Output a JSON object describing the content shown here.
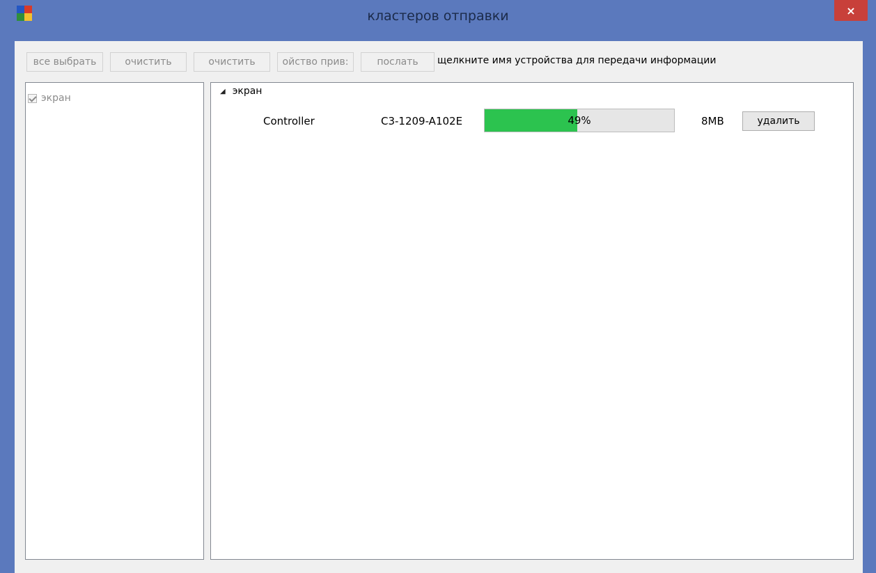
{
  "window": {
    "title": "кластеров отправки",
    "close_label": "×"
  },
  "toolbar": {
    "buttons": [
      {
        "label": "все выбрать"
      },
      {
        "label": "очистить"
      },
      {
        "label": "очистить"
      },
      {
        "label": "ойство прив:"
      },
      {
        "label": "послать"
      }
    ],
    "hint": "щелкните имя устройства для передачи информации"
  },
  "left_panel": {
    "items": [
      {
        "label": "экран",
        "checked": true
      }
    ]
  },
  "right_panel": {
    "group": {
      "label": "экран",
      "expander": "◢",
      "devices": [
        {
          "name": "Controller",
          "id": "C3-1209-A102E",
          "progress_text": "49%",
          "progress": 0.49,
          "size": "8MB",
          "delete_label": "удалить"
        }
      ]
    }
  },
  "colors": {
    "window_frame": "#5b79bd",
    "close_button": "#c8403a",
    "progress_fill": "#2cc34f"
  }
}
